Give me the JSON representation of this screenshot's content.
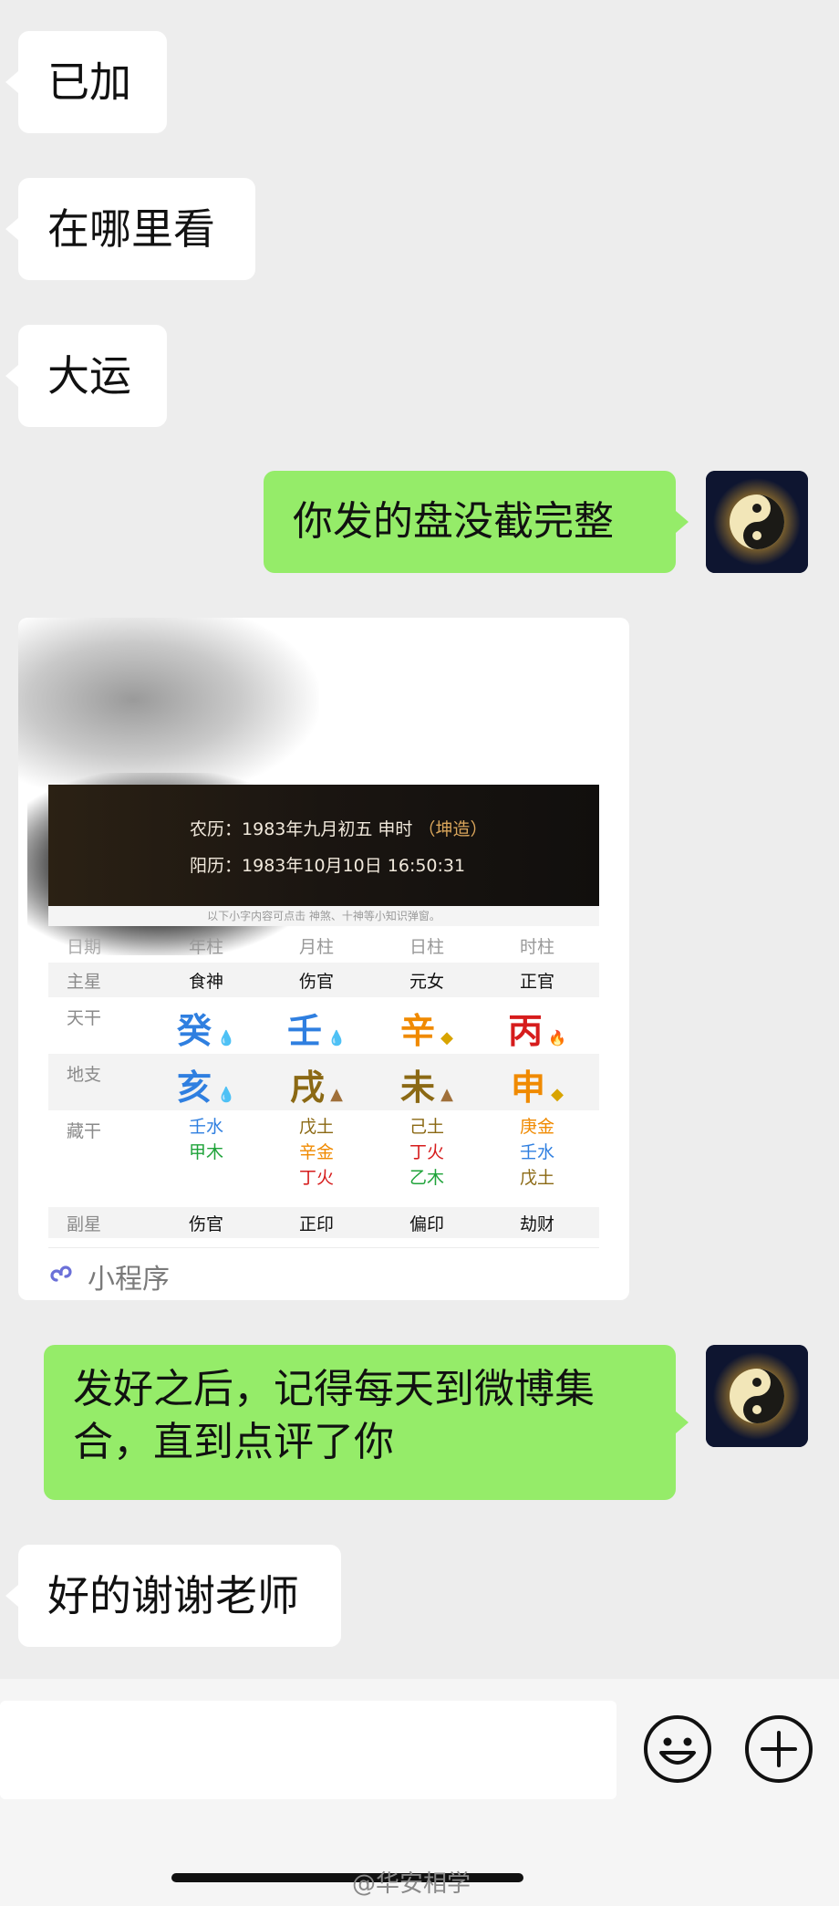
{
  "messages": {
    "m1": "已加",
    "m2": "在哪里看",
    "m3": "大运",
    "m4": "你发的盘没截完整",
    "m6_line1": "发好之后，记得每天到微博集",
    "m6_line2": "合，直到点评了你",
    "m7": "好的谢谢老师"
  },
  "card": {
    "lunar_prefix": "农历：",
    "lunar_date": "1983年九月初五 申时",
    "gender": "（坤造）",
    "solar_prefix": "阳历：",
    "solar_date": "1983年10月10日 16:50:31",
    "notice": "以下小字内容可点击 神煞、十神等小知识弹窗。",
    "columns": [
      "年柱",
      "月柱",
      "日柱",
      "时柱"
    ],
    "col0_label": "日期",
    "labels": {
      "zhuxing": "主星",
      "tiangan": "天干",
      "dizhi": "地支",
      "canggan": "藏干",
      "fuxing": "副星"
    },
    "zhuxing": [
      "食神",
      "伤官",
      "元女",
      "正官"
    ],
    "tiangan": [
      "癸",
      "壬",
      "辛",
      "丙"
    ],
    "dizhi": [
      "亥",
      "戌",
      "未",
      "申"
    ],
    "canggan": [
      [
        "壬水",
        "甲木"
      ],
      [
        "戊土",
        "辛金",
        "丁火"
      ],
      [
        "己土",
        "丁火",
        "乙木"
      ],
      [
        "庚金",
        "壬水",
        "戊土"
      ]
    ],
    "fuxing": [
      "伤官",
      "正印",
      "偏印",
      "劫财"
    ],
    "footer": "小程序"
  },
  "colors": {
    "water": "#2f7fe0",
    "metal": "#f08a00",
    "fire": "#d61c1c",
    "earth": "#8b6914",
    "wood": "#1fa33a",
    "self_bubble": "#95ec69",
    "other_bubble": "#ffffff"
  },
  "watermark": "@华安相学",
  "icons": [
    "emoji-icon",
    "plus-icon",
    "mini-program-icon",
    "yin-yang-avatar"
  ]
}
